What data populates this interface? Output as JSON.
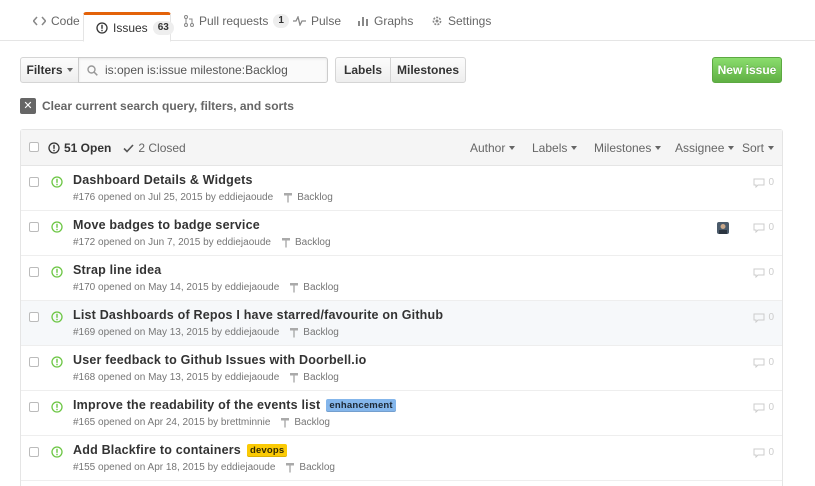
{
  "nav": {
    "tabs": [
      {
        "label": "Code"
      },
      {
        "label": "Issues",
        "count": "63"
      },
      {
        "label": "Pull requests",
        "count": "1"
      },
      {
        "label": "Pulse"
      },
      {
        "label": "Graphs"
      },
      {
        "label": "Settings"
      }
    ]
  },
  "subnav": {
    "filters_label": "Filters",
    "search_value": "is:open is:issue milestone:Backlog",
    "labels_label": "Labels",
    "milestones_label": "Milestones",
    "new_issue_label": "New issue"
  },
  "clear_filter_label": "Clear current search query, filters, and sorts",
  "table_header": {
    "open_label": "51 Open",
    "closed_label": "2 Closed",
    "author_label": "Author",
    "labels_label": "Labels",
    "milestones_label": "Milestones",
    "assignee_label": "Assignee",
    "sort_label": "Sort"
  },
  "colors": {
    "open_green": "#6cc644",
    "label_enhancement": "#84b6eb",
    "label_devops": "#fbca04",
    "new_issue_green": "#60b044"
  },
  "issues": [
    {
      "title": "Dashboard Details & Widgets",
      "meta": "#176 opened on Jul 25, 2015 by",
      "author": "eddiejaoude",
      "milestone": "Backlog",
      "comments": "0",
      "label": "",
      "label_color": ""
    },
    {
      "title": "Move badges to badge service",
      "meta": "#172 opened on Jun 7, 2015 by",
      "author": "eddiejaoude",
      "milestone": "Backlog",
      "comments": "0",
      "label": "",
      "label_color": "",
      "has_assignee": true
    },
    {
      "title": "Strap line idea",
      "meta": "#170 opened on May 14, 2015 by",
      "author": "eddiejaoude",
      "milestone": "Backlog",
      "comments": "0",
      "label": "",
      "label_color": ""
    },
    {
      "title": "List Dashboards of Repos I have starred/favourite on Github",
      "meta": "#169 opened on May 13, 2015 by",
      "author": "eddiejaoude",
      "milestone": "Backlog",
      "comments": "0",
      "label": "",
      "label_color": "",
      "hover": true
    },
    {
      "title": "User feedback to Github Issues with Doorbell.io",
      "meta": "#168 opened on May 13, 2015 by",
      "author": "eddiejaoude",
      "milestone": "Backlog",
      "comments": "0",
      "label": "",
      "label_color": ""
    },
    {
      "title": "Improve the readability of the events list",
      "meta": "#165 opened on Apr 24, 2015 by",
      "author": "brettminnie",
      "milestone": "Backlog",
      "comments": "0",
      "label": "enhancement",
      "label_color": "#84b6eb",
      "label_text_color": "#1c2733"
    },
    {
      "title": "Add Blackfire to containers",
      "meta": "#155 opened on Apr 18, 2015 by",
      "author": "eddiejaoude",
      "milestone": "Backlog",
      "comments": "0",
      "label": "devops",
      "label_color": "#fbca04",
      "label_text_color": "#332900"
    }
  ]
}
